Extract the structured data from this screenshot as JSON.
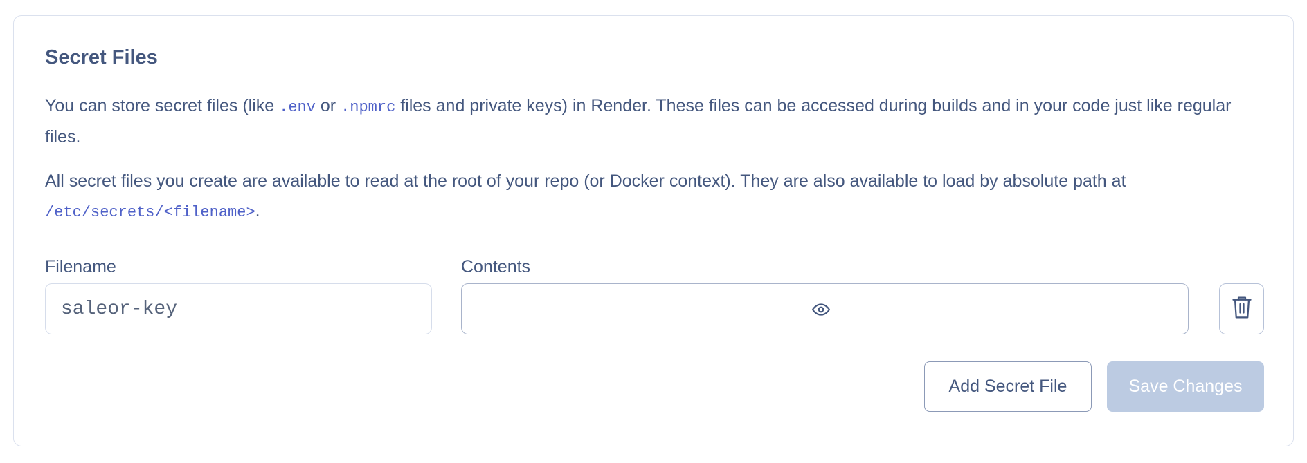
{
  "section": {
    "title": "Secret Files",
    "paragraph1": {
      "text_before_env": "You can store secret files (like ",
      "code_env": ".env",
      "text_or": " or ",
      "code_npmrc": ".npmrc",
      "text_after_npmrc": " files and private keys) in Render. These files can be accessed during builds and in your code just like regular files."
    },
    "paragraph2": {
      "text": "All secret files you create are available to read at the root of your repo (or Docker context). They are also available to load by absolute path at ",
      "code_path": "/etc/secrets/<filename>",
      "text_end": "."
    }
  },
  "form": {
    "filename_label": "Filename",
    "contents_label": "Contents",
    "filename_value": "saleor-key",
    "contents_value": ""
  },
  "icons": {
    "reveal": "eye-icon",
    "delete": "trash-icon"
  },
  "actions": {
    "add_label": "Add Secret File",
    "save_label": "Save Changes",
    "save_disabled": true
  },
  "colors": {
    "text": "#44577e",
    "code": "#4f61c8",
    "border": "#dbe1ee",
    "save_disabled_bg": "#bccbe2"
  }
}
